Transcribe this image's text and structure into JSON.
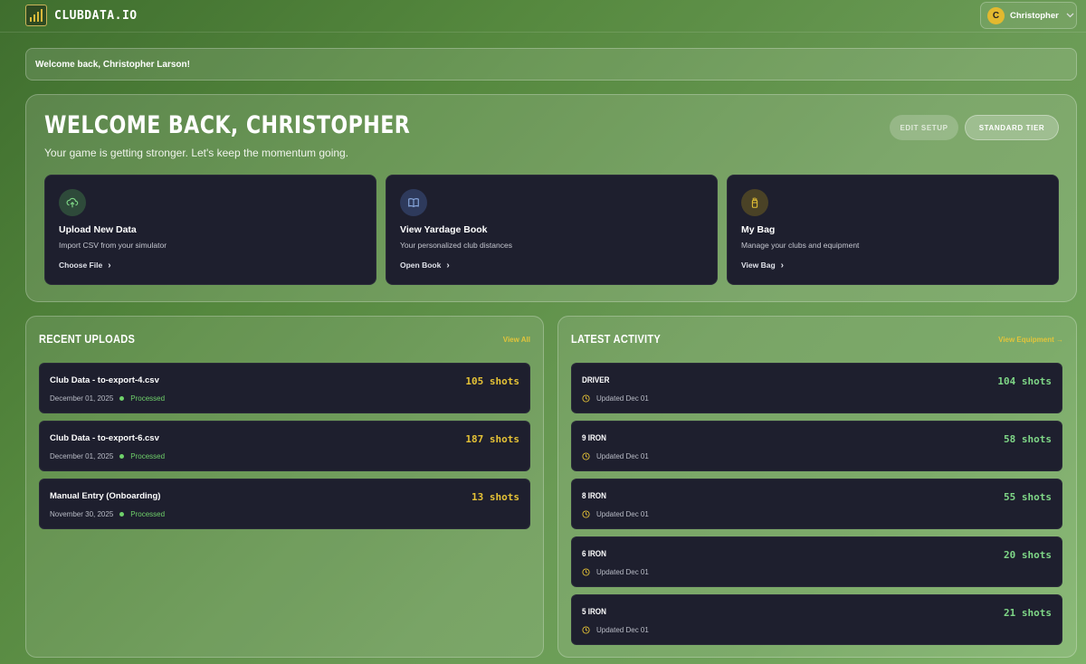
{
  "app": {
    "logo_text": "CLUBDATA.IO"
  },
  "user": {
    "initial": "C",
    "name": "Christopher"
  },
  "welcome_bar": {
    "text": "Welcome back, Christopher Larson!"
  },
  "hero": {
    "title": "WELCOME BACK, CHRISTOPHER",
    "subtitle": "Your game is getting stronger. Let's keep the momentum going.",
    "edit_setup_label": "EDIT SETUP",
    "tier_label": "STANDARD TIER",
    "cards": [
      {
        "icon": "upload-cloud-icon",
        "title": "Upload New Data",
        "description": "Import CSV from your simulator",
        "link": "Choose File",
        "icon_bg": "#2e4a3a",
        "icon_color": "#7fd787"
      },
      {
        "icon": "book-icon",
        "title": "View Yardage Book",
        "description": "Your personalized club distances",
        "link": "Open Book",
        "icon_bg": "#2e3a5c",
        "icon_color": "#8fb0e8"
      },
      {
        "icon": "golf-bag-icon",
        "title": "My Bag",
        "description": "Manage your clubs and equipment",
        "link": "View Bag",
        "icon_bg": "#4a4226",
        "icon_color": "#e5c236"
      }
    ]
  },
  "recent_uploads": {
    "title": "RECENT UPLOADS",
    "view_all": "View All",
    "items": [
      {
        "name": "Club Data - to-export-4.csv",
        "date": "December 01, 2025",
        "status": "Processed",
        "shots": "105 shots"
      },
      {
        "name": "Club Data - to-export-6.csv",
        "date": "December 01, 2025",
        "status": "Processed",
        "shots": "187 shots"
      },
      {
        "name": "Manual Entry (Onboarding)",
        "date": "November 30, 2025",
        "status": "Processed",
        "shots": "13 shots"
      }
    ]
  },
  "latest_activity": {
    "title": "LATEST ACTIVITY",
    "view_equipment": "View Equipment →",
    "items": [
      {
        "club": "DRIVER",
        "updated": "Updated Dec 01",
        "shots": "104 shots"
      },
      {
        "club": "9 IRON",
        "updated": "Updated Dec 01",
        "shots": "58 shots"
      },
      {
        "club": "8 IRON",
        "updated": "Updated Dec 01",
        "shots": "55 shots"
      },
      {
        "club": "6 IRON",
        "updated": "Updated Dec 01",
        "shots": "20 shots"
      },
      {
        "club": "5 IRON",
        "updated": "Updated Dec 01",
        "shots": "21 shots"
      }
    ]
  },
  "colors": {
    "accent_gold": "#e5c236",
    "accent_green": "#7fd787",
    "card_bg": "#1e1f2e"
  }
}
